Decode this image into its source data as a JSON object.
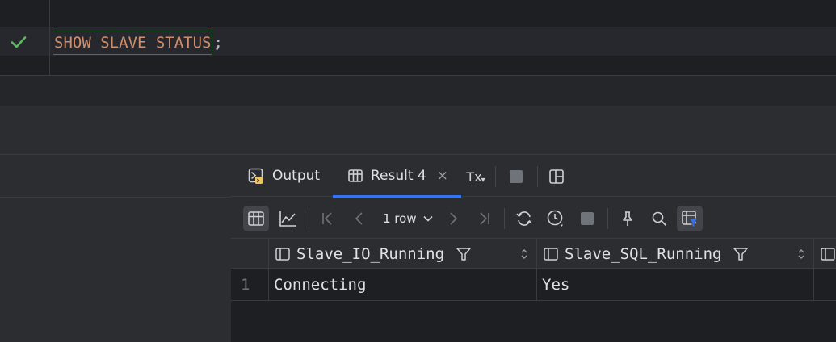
{
  "editor": {
    "status_icon": "check-icon",
    "statement": "SHOW SLAVE STATUS",
    "terminator": ";"
  },
  "tabs": {
    "output_label": "Output",
    "result_label": "Result 4",
    "close_glyph": "×",
    "tx_label": "Tx"
  },
  "toolbar": {
    "row_count_label": "1 row"
  },
  "grid": {
    "columns": [
      "Slave_IO_Running",
      "Slave_SQL_Running"
    ],
    "rows": [
      {
        "num": "1",
        "cells": [
          "Connecting",
          "Yes"
        ]
      }
    ]
  },
  "colors": {
    "accent": "#3574f0",
    "success": "#5fb865",
    "keyword": "#cf8e6d"
  }
}
